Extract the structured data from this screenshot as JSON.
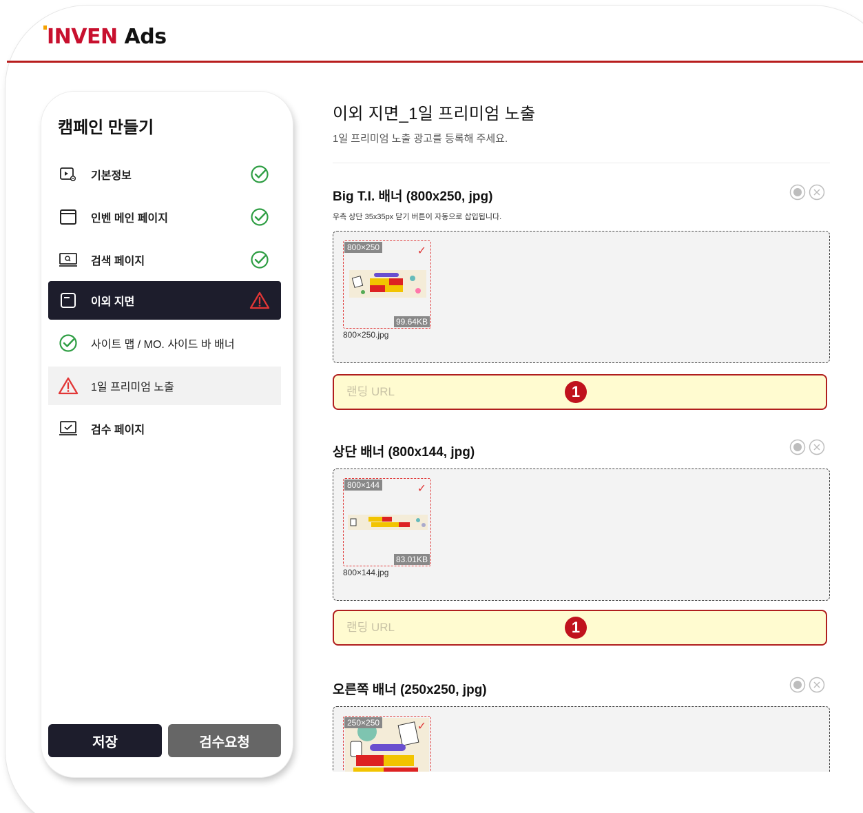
{
  "brand": {
    "inven": "INVEN",
    "ads": " Ads"
  },
  "sidebar": {
    "title": "캠페인 만들기",
    "items": [
      {
        "label": "기본정보",
        "icon": "media-settings-icon",
        "status": "done"
      },
      {
        "label": "인벤 메인 페이지",
        "icon": "window-icon",
        "status": "done"
      },
      {
        "label": "검색 페이지",
        "icon": "search-page-icon",
        "status": "done"
      },
      {
        "label": "이외 지면",
        "icon": "window-icon",
        "status": "warning"
      },
      {
        "label": "사이트 맵 / MO. 사이드 바 배너",
        "icon": "check-circle-icon",
        "status": "done"
      },
      {
        "label": "1일 프리미엄 노출",
        "icon": "warning-icon",
        "status": "warning"
      },
      {
        "label": "검수 페이지",
        "icon": "review-icon",
        "status": "none"
      }
    ],
    "save_label": "저장",
    "review_label": "검수요청"
  },
  "main": {
    "title": "이외 지면_1일 프리미엄 노출",
    "subtitle": "1일 프리미엄 노출 광고를 등록해 주세요.",
    "sections": [
      {
        "title": "Big T.I. 배너 (800x250, jpg)",
        "note": "우측 상단 35x35px 닫기 버튼이 자동으로 삽입됩니다.",
        "thumb_dim": "800×250",
        "thumb_size": "99.64KB",
        "file_name": "800×250.jpg",
        "url_placeholder": "랜딩 URL",
        "badge": "1"
      },
      {
        "title": "상단 배너 (800x144, jpg)",
        "thumb_dim": "800×144",
        "thumb_size": "83.01KB",
        "file_name": "800×144.jpg",
        "url_placeholder": "랜딩 URL",
        "badge": "1"
      },
      {
        "title": "오른쪽 배너 (250x250, jpg)",
        "thumb_dim": "250×250"
      }
    ]
  },
  "colors": {
    "brand_red": "#c8102e",
    "header_line": "#b81d1d",
    "dark_nav": "#1d1d2c",
    "success_green": "#2f9e44",
    "warning_red": "#d6282b",
    "url_bg": "#fffbd0"
  }
}
